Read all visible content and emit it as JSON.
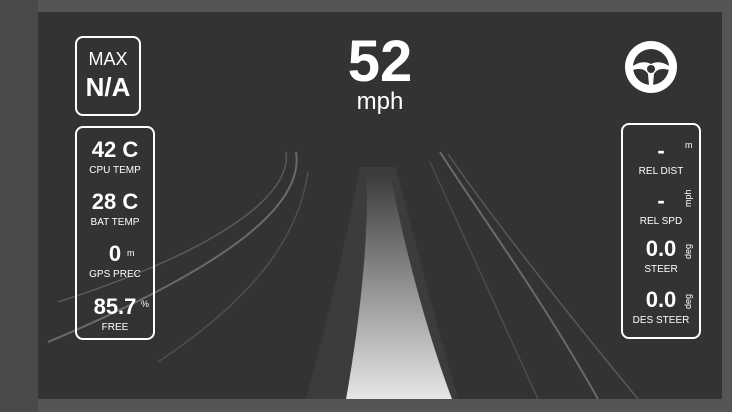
{
  "max": {
    "label": "MAX",
    "value": "N/A"
  },
  "speed": {
    "value": "52",
    "unit": "mph"
  },
  "left_panel": {
    "cpu_temp": {
      "value": "42 C",
      "label": "CPU TEMP"
    },
    "bat_temp": {
      "value": "28 C",
      "label": "BAT TEMP"
    },
    "gps_prec": {
      "value": "0",
      "unit": "m",
      "label": "GPS PREC"
    },
    "free": {
      "value": "85.7",
      "unit": "%",
      "label": "FREE"
    }
  },
  "right_panel": {
    "rel_dist": {
      "value": "-",
      "unit": "m",
      "label": "REL DIST"
    },
    "rel_spd": {
      "value": "-",
      "unit": "mph",
      "label": "REL SPD"
    },
    "steer": {
      "value": "0.0",
      "unit": "deg",
      "label": "STEER"
    },
    "des_steer": {
      "value": "0.0",
      "unit": "deg",
      "label": "DES STEER"
    }
  },
  "icons": {
    "engage": "steering-wheel-icon"
  },
  "colors": {
    "background": "#333333",
    "text": "#ffffff",
    "frame": "#555555",
    "path_light": "#d9d9d9"
  }
}
